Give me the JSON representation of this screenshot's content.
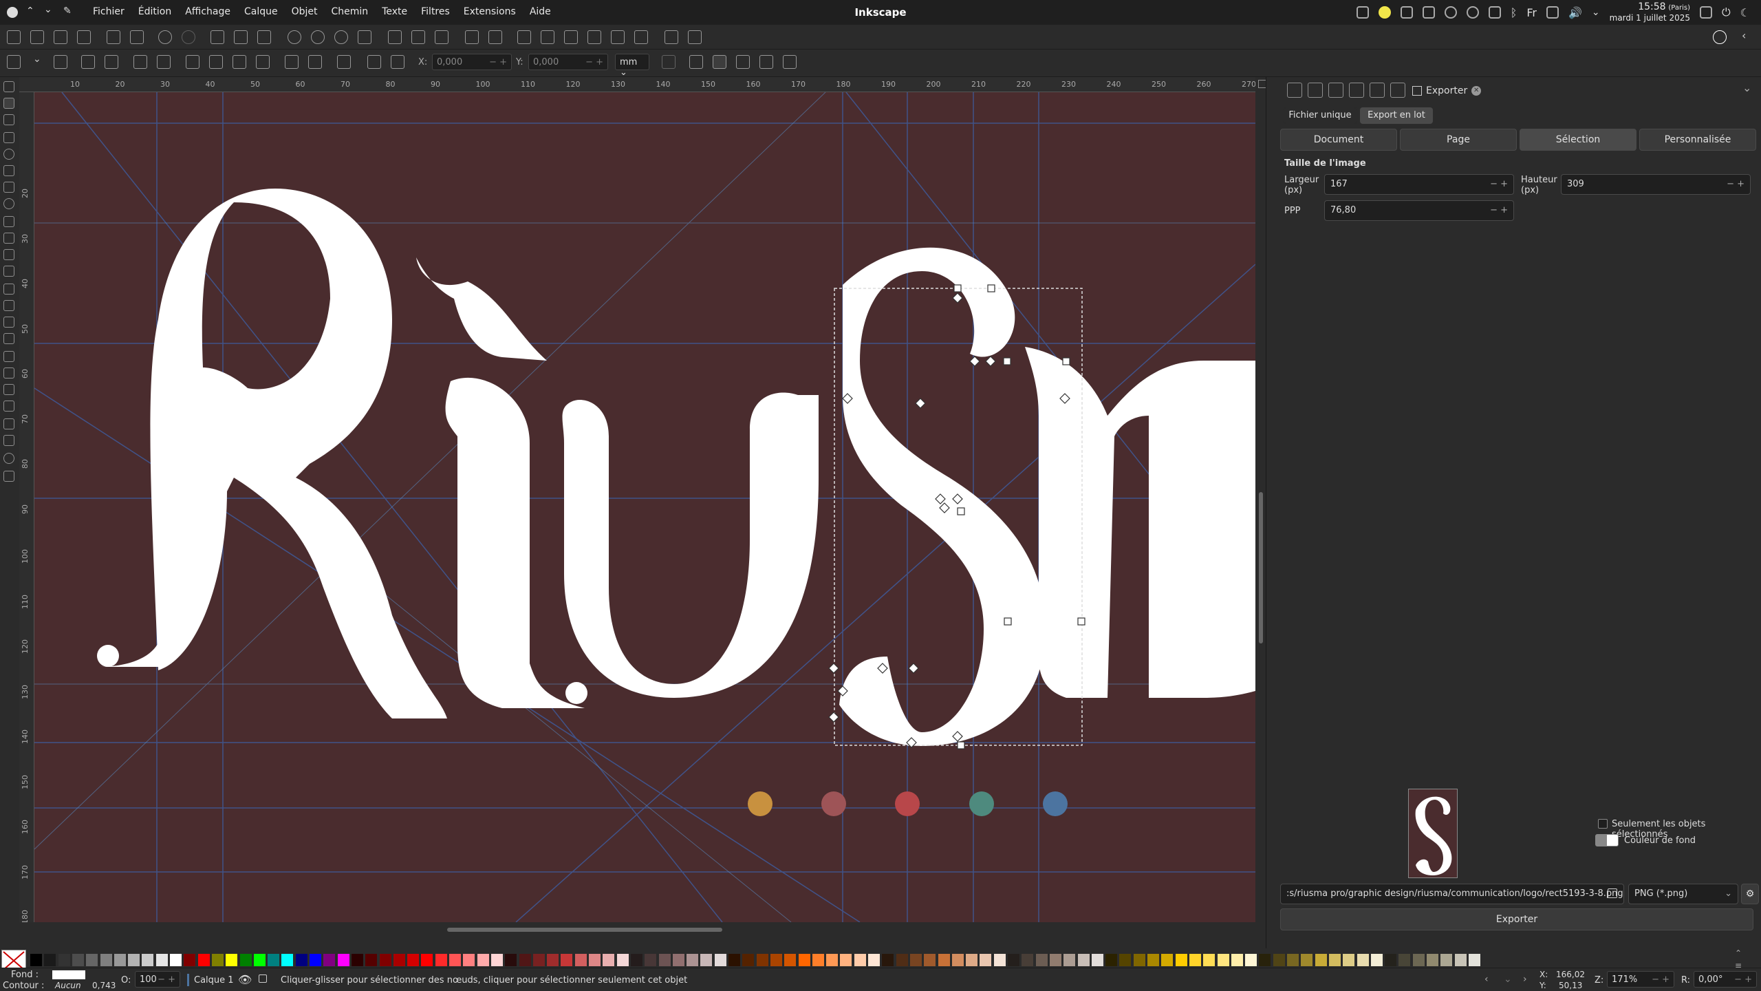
{
  "app": {
    "title": "Inkscape"
  },
  "menu": [
    "Fichier",
    "Édition",
    "Affichage",
    "Calque",
    "Objet",
    "Chemin",
    "Texte",
    "Filtres",
    "Extensions",
    "Aide"
  ],
  "clock": {
    "time": "15:58",
    "tz": "(Paris)",
    "date": "mardi 1 juillet 2025"
  },
  "toolcontrols": {
    "x_label": "X:",
    "x_value": "0,000",
    "y_label": "Y:",
    "y_value": "0,000",
    "unit": "mm"
  },
  "ruler": {
    "h": [
      "10",
      "20",
      "30",
      "40",
      "50",
      "60",
      "70",
      "80",
      "90",
      "100",
      "110",
      "120",
      "130",
      "140",
      "150",
      "160",
      "170",
      "180",
      "190",
      "200",
      "210",
      "220",
      "230",
      "240",
      "250",
      "260",
      "270"
    ],
    "v": [
      "20",
      "30",
      "40",
      "50",
      "60",
      "70",
      "80",
      "90",
      "100",
      "110",
      "120",
      "130",
      "140",
      "150",
      "160",
      "170",
      "180"
    ]
  },
  "canvas": {
    "lettering": "Riusma",
    "bg": "#4a2c2e",
    "dots": [
      "#c8913f",
      "#9e5457",
      "#b8474a",
      "#4e8a7e",
      "#4c74a0"
    ]
  },
  "panel": {
    "tab_title": "Exporter",
    "export_modes": [
      "Fichier unique",
      "Export en lot"
    ],
    "areas": [
      "Document",
      "Page",
      "Sélection",
      "Personnalisée"
    ],
    "selected_area": "Sélection",
    "section": "Taille de l'image",
    "width_label": "Largeur (px)",
    "width_value": "167",
    "height_label": "Hauteur (px)",
    "height_value": "309",
    "dpi_label": "PPP",
    "dpi_value": "76,80",
    "only_selected": "Seulement les objets sélectionnés",
    "bg_color": "Couleur de fond",
    "filename": ":s/riusma pro/graphic design/riusma/communication/logo/rect5193-3-8.png",
    "format": "PNG (*.png)",
    "export_button": "Exporter"
  },
  "status": {
    "fill_label": "Fond :",
    "stroke_label": "Contour :",
    "stroke_value": "Aucun",
    "stroke_width": "0,743",
    "opacity_label": "O:",
    "opacity_value": "100",
    "layer": "Calque 1",
    "message": "Cliquer-glisser pour sélectionner des nœuds, cliquer pour sélectionner seulement cet objet",
    "x_label": "X:",
    "x_value": "166,02",
    "y_label": "Y:",
    "y_value": "50,13",
    "zoom_label": "Z:",
    "zoom_value": "171%",
    "rot_label": "R:",
    "rot_value": "0,00°"
  },
  "palette_colors": [
    "#000000",
    "#1a1a1a",
    "#333333",
    "#4d4d4d",
    "#666666",
    "#808080",
    "#999999",
    "#b3b3b3",
    "#cccccc",
    "#e6e6e6",
    "#ffffff",
    "#800000",
    "#ff0000",
    "#808000",
    "#ffff00",
    "#008000",
    "#00ff00",
    "#008080",
    "#00ffff",
    "#000080",
    "#0000ff",
    "#800080",
    "#ff00ff",
    "#2b0000",
    "#550000",
    "#800000",
    "#aa0000",
    "#d40000",
    "#ff0000",
    "#ff2a2a",
    "#ff5555",
    "#ff8080",
    "#ffaaaa",
    "#ffd5d5",
    "#280b0b",
    "#501616",
    "#782121",
    "#a02c2c",
    "#c83737",
    "#d35f5f",
    "#de8787",
    "#e9afaf",
    "#f4d7d7",
    "#241c1c",
    "#483737",
    "#6c5353",
    "#916f6f",
    "#ac9393",
    "#c8b7b7",
    "#e3dbdb",
    "#2b1100",
    "#552200",
    "#803300",
    "#aa4400",
    "#d45500",
    "#ff6600",
    "#ff7f2a",
    "#ff9955",
    "#ffb380",
    "#ffccaa",
    "#ffe6d5",
    "#28170b",
    "#502d16",
    "#784421",
    "#a05a2c",
    "#c87137",
    "#d38d5f",
    "#deaa87",
    "#e9c6af",
    "#f4e3d7",
    "#241f1c",
    "#483e37",
    "#6c5d53",
    "#917c6f",
    "#ac9d93",
    "#c8beb7",
    "#e3dedb",
    "#2b2200",
    "#554400",
    "#806600",
    "#aa8800",
    "#d4aa00",
    "#ffcc00",
    "#ffd42a",
    "#ffdd55",
    "#ffe680",
    "#ffeeaa",
    "#fff6d5",
    "#28220b",
    "#504416",
    "#786721",
    "#a0892c",
    "#c8ab37",
    "#d3bc5f",
    "#decd87",
    "#e9ddaf",
    "#f4eed7",
    "#24221c",
    "#484537",
    "#6c6753",
    "#918a6f",
    "#aca793",
    "#c8c4b7",
    "#e3e2db"
  ]
}
